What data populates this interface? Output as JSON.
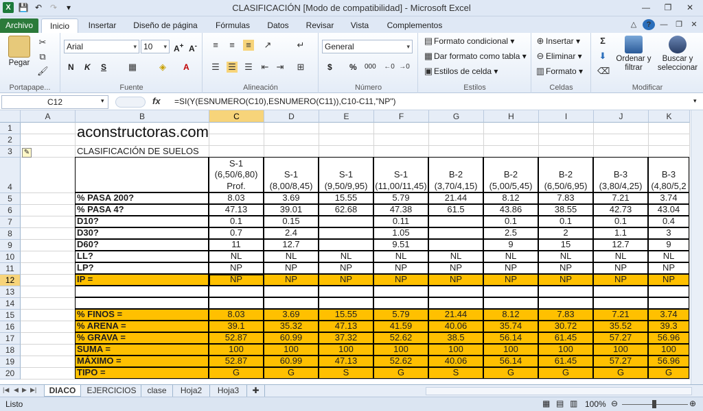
{
  "window": {
    "title": "CLASIFICACIÓN  [Modo de compatibilidad]  -  Microsoft Excel"
  },
  "tabs": [
    "Archivo",
    "Inicio",
    "Insertar",
    "Diseño de página",
    "Fórmulas",
    "Datos",
    "Revisar",
    "Vista",
    "Complementos"
  ],
  "ribbon": {
    "paste": "Pegar",
    "font_name": "Arial",
    "font_size": "10",
    "number_format": "General",
    "conditional": "Formato condicional",
    "table_format": "Dar formato como tabla",
    "cell_styles": "Estilos de celda",
    "insert": "Insertar",
    "delete": "Eliminar",
    "format": "Formato",
    "sort": "Ordenar y filtrar",
    "find": "Buscar y seleccionar",
    "groups": {
      "clipboard": "Portapape...",
      "font": "Fuente",
      "alignment": "Alineación",
      "number": "Número",
      "styles": "Estilos",
      "cells": "Celdas",
      "edit": "Modificar"
    },
    "bold": "N",
    "italic": "K",
    "underline": "S",
    "currency": "$",
    "percent": "%",
    "thousands": "000"
  },
  "formula_bar": {
    "name_box": "C12",
    "fx": "fx",
    "formula": "=SI(Y(ESNUMERO(C10),ESNUMERO(C11)),C10-C11,\"NP\")"
  },
  "columns": [
    "A",
    "B",
    "C",
    "D",
    "E",
    "F",
    "G",
    "H",
    "I",
    "J",
    "K"
  ],
  "rows": [
    "1",
    "2",
    "3",
    "4",
    "5",
    "6",
    "7",
    "8",
    "9",
    "10",
    "11",
    "12",
    "13",
    "14",
    "15",
    "16",
    "17",
    "18",
    "19",
    "20"
  ],
  "sheet": {
    "brand": "aconstructoras.com",
    "title": "CLASIFICACIÓN DE SUELOS",
    "headers": [
      "S-1 (6,50/6,80) Prof.",
      "S-1 (8,00/8,45)",
      "S-1 (9,50/9,95)",
      "S-1 (11,00/11,45)",
      "B-2 (3,70/4,15)",
      "B-2 (5,00/5,45)",
      "B-2 (6,50/6,95)",
      "B-3 (3,80/4,25)",
      "B-3 (4,80/5,2"
    ],
    "labels": {
      "r5": "% PASA 200?",
      "r6": "% PASA 4?",
      "r7": "D10?",
      "r8": "D30?",
      "r9": "D60?",
      "r10": "LL?",
      "r11": "LP?",
      "r12": "IP =",
      "r15": "% FINOS =",
      "r16": "% ARENA =",
      "r17": "% GRAVA =",
      "r18": "SUMA =",
      "r19": "MÁXIMO =",
      "r20": "TIPO ="
    },
    "data": {
      "r5": [
        "8.03",
        "3.69",
        "15.55",
        "5.79",
        "21.44",
        "8.12",
        "7.83",
        "7.21",
        "3.74"
      ],
      "r6": [
        "47.13",
        "39.01",
        "62.68",
        "47.38",
        "61.5",
        "43.86",
        "38.55",
        "42.73",
        "43.04"
      ],
      "r7": [
        "0.1",
        "0.15",
        "",
        "0.11",
        "",
        "0.1",
        "0.1",
        "0.1",
        "0.4"
      ],
      "r8": [
        "0.7",
        "2.4",
        "",
        "1.05",
        "",
        "2.5",
        "2",
        "1.1",
        "3"
      ],
      "r9": [
        "11",
        "12.7",
        "",
        "9.51",
        "",
        "9",
        "15",
        "12.7",
        "9"
      ],
      "r10": [
        "NL",
        "NL",
        "NL",
        "NL",
        "NL",
        "NL",
        "NL",
        "NL",
        "NL"
      ],
      "r11": [
        "NP",
        "NP",
        "NP",
        "NP",
        "NP",
        "NP",
        "NP",
        "NP",
        "NP"
      ],
      "r12": [
        "NP",
        "NP",
        "NP",
        "NP",
        "NP",
        "NP",
        "NP",
        "NP",
        "NP"
      ],
      "r15": [
        "8.03",
        "3.69",
        "15.55",
        "5.79",
        "21.44",
        "8.12",
        "7.83",
        "7.21",
        "3.74"
      ],
      "r16": [
        "39.1",
        "35.32",
        "47.13",
        "41.59",
        "40.06",
        "35.74",
        "30.72",
        "35.52",
        "39.3"
      ],
      "r17": [
        "52.87",
        "60.99",
        "37.32",
        "52.62",
        "38.5",
        "56.14",
        "61.45",
        "57.27",
        "56.96"
      ],
      "r18": [
        "100",
        "100",
        "100",
        "100",
        "100",
        "100",
        "100",
        "100",
        "100"
      ],
      "r19": [
        "52.87",
        "60.99",
        "47.13",
        "52.62",
        "40.06",
        "56.14",
        "61.45",
        "57.27",
        "56.96"
      ],
      "r20": [
        "G",
        "G",
        "S",
        "G",
        "S",
        "G",
        "G",
        "G",
        "G"
      ]
    }
  },
  "sheet_tabs": [
    "DIACO",
    "EJERCICIOS",
    "clase",
    "Hoja2",
    "Hoja3"
  ],
  "status": {
    "ready": "Listo",
    "zoom": "100%"
  },
  "colors": {
    "accent": "#ffc000",
    "file_tab": "#2b7a3a",
    "selected_header": "#f7d47a"
  }
}
